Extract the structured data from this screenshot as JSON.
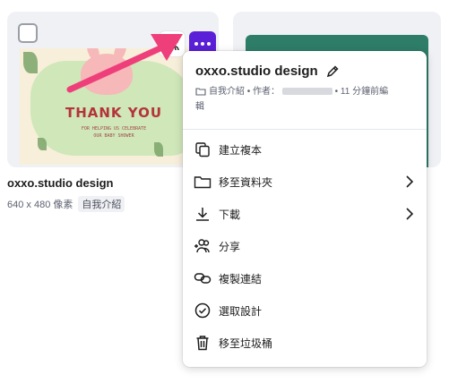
{
  "design_card": {
    "thumbnail": {
      "headline": "THANK YOU",
      "subline_1": "FOR HELPING US CELEBRATE",
      "subline_2": "OUR BABY SHOWER"
    },
    "title": "oxxo.studio design",
    "dimensions": "640 x 480 像素",
    "tag": "自我介紹"
  },
  "menu": {
    "title": "oxxo.studio design",
    "info_prefix": "自我介紹 • 作者：",
    "info_suffix": "• 11 分鐘前編",
    "info_wrap": "輯",
    "items": [
      {
        "label": "建立複本",
        "icon": "duplicate-icon"
      },
      {
        "label": "移至資料夾",
        "icon": "folder-icon",
        "submenu": true
      },
      {
        "label": "下載",
        "icon": "download-icon",
        "submenu": true
      },
      {
        "label": "分享",
        "icon": "share-people-icon"
      },
      {
        "label": "複製連結",
        "icon": "link-icon"
      },
      {
        "label": "選取設計",
        "icon": "check-circle-icon"
      },
      {
        "label": "移至垃圾桶",
        "icon": "trash-icon"
      }
    ]
  },
  "colors": {
    "more_button": "#5a1fd6",
    "annotation_arrow": "#ee3f7a",
    "second_thumb": "#2e7d69"
  }
}
